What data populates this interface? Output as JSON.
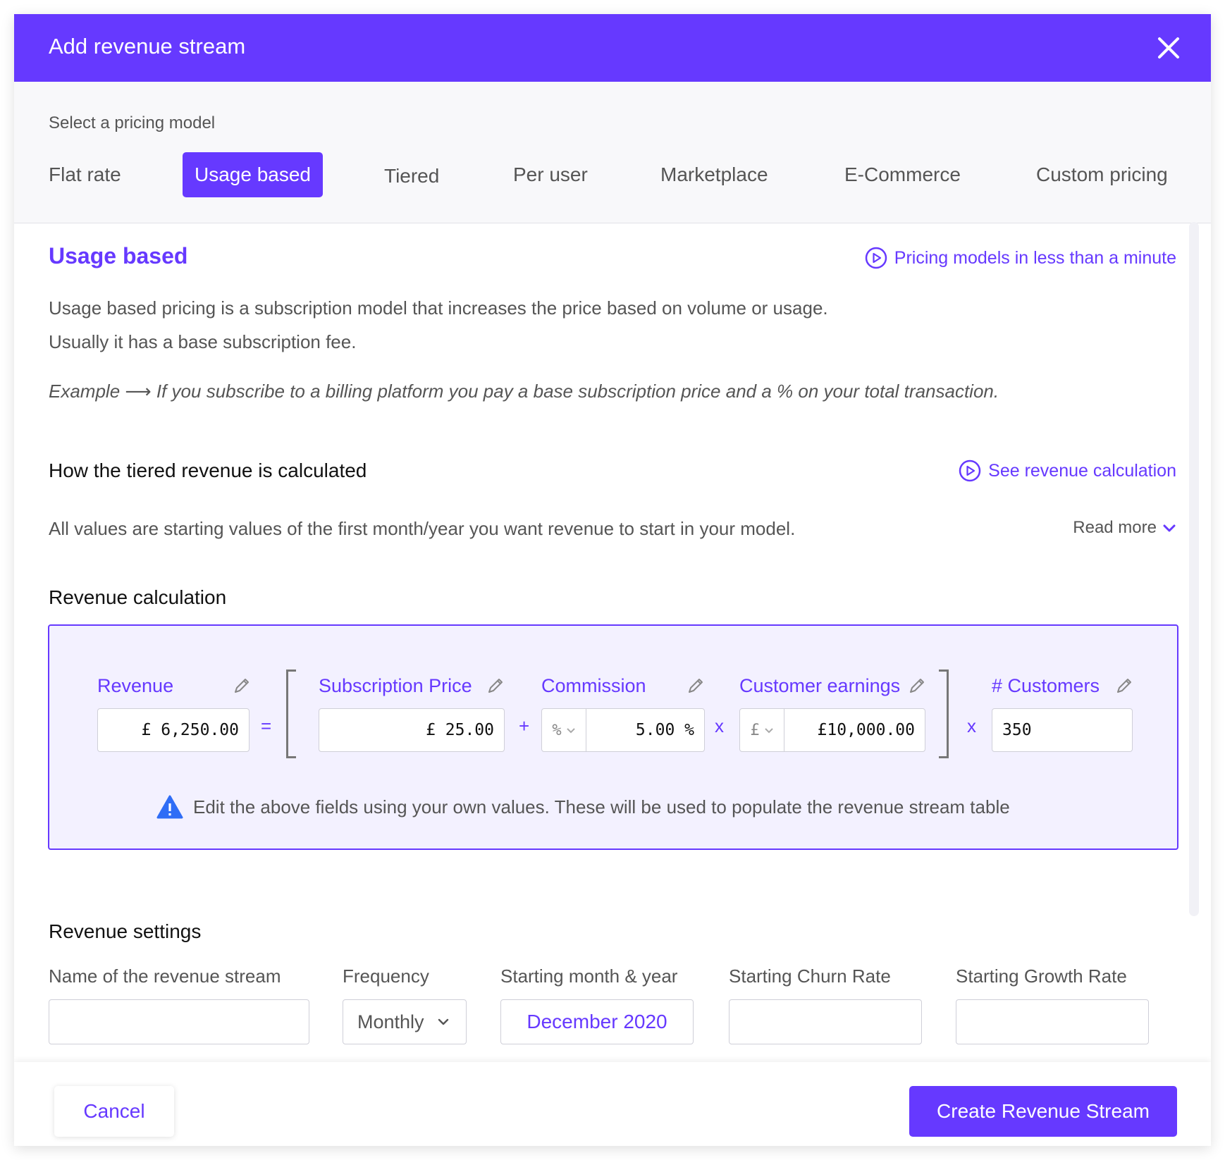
{
  "header": {
    "title": "Add revenue stream",
    "close_icon": "close-icon"
  },
  "pricing": {
    "caption": "Select a pricing model",
    "tabs": [
      {
        "label": "Flat rate"
      },
      {
        "label": "Usage based",
        "active": true
      },
      {
        "label": "Tiered"
      },
      {
        "label": "Per user"
      },
      {
        "label": "Marketplace"
      },
      {
        "label": "E-Commerce"
      },
      {
        "label": "Custom pricing"
      }
    ]
  },
  "intro": {
    "title": "Usage based",
    "video_link": "Pricing models in less than a minute",
    "desc_line1": "Usage based pricing is a subscription model that increases the price based on volume or usage.",
    "desc_line2": "Usually it has a base subscription fee.",
    "example": "Example ⟶ If you subscribe to a billing platform you pay a base subscription price and a % on your total transaction."
  },
  "how": {
    "heading": "How the tiered revenue is calculated",
    "link": "See revenue calculation",
    "text": "All values are starting values of the first month/year you want revenue to start in your model.",
    "read_more": "Read more"
  },
  "calc": {
    "heading": "Revenue calculation",
    "revenue_label": "Revenue",
    "revenue_value": "£ 6,250.00",
    "eq": "=",
    "subscription_label": "Subscription Price",
    "subscription_value": "£ 25.00",
    "plus": "+",
    "commission_label": "Commission",
    "commission_unit": "%",
    "commission_value": "5.00 %",
    "times": "x",
    "earnings_label": "Customer earnings",
    "earnings_unit": "£",
    "earnings_value": "£10,000.00",
    "customers_label": "# Customers",
    "customers_value": "350",
    "notice": "Edit the above fields using your own values. These will be used to populate the revenue stream table",
    "accent": "#6639ff"
  },
  "settings": {
    "heading": "Revenue settings",
    "name_label": "Name of the revenue stream",
    "name_value": "",
    "frequency_label": "Frequency",
    "frequency_value": "Monthly",
    "start_label": "Starting month & year",
    "start_value": "December 2020",
    "churn_label": "Starting Churn Rate",
    "churn_value": "",
    "growth_label": "Starting Growth Rate",
    "growth_value": ""
  },
  "footer": {
    "cancel": "Cancel",
    "create": "Create Revenue Stream"
  }
}
